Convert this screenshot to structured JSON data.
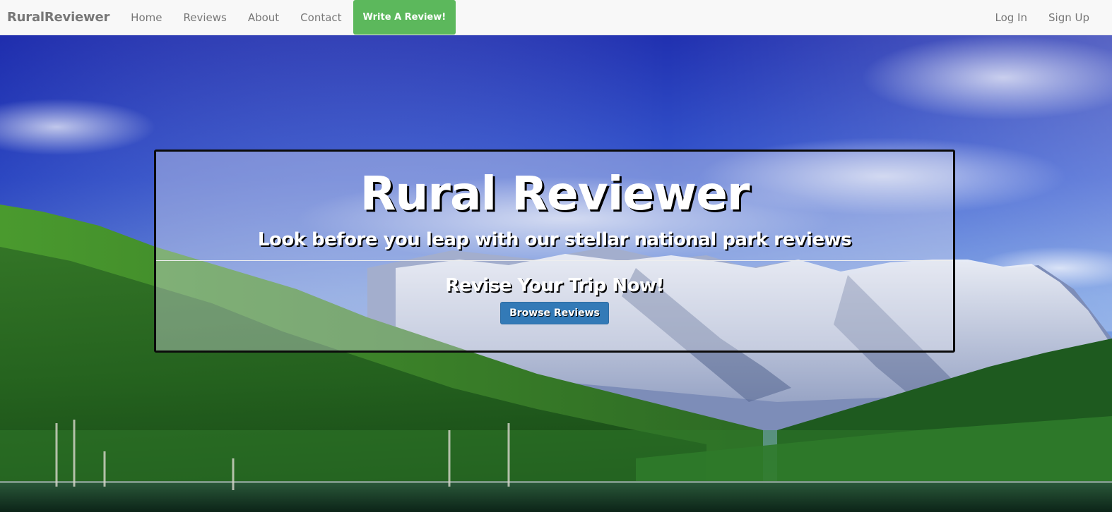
{
  "navbar": {
    "brand": "RuralReviewer",
    "links": [
      "Home",
      "Reviews",
      "About",
      "Contact"
    ],
    "cta": "Write A Review!",
    "right_links": [
      "Log In",
      "Sign Up"
    ]
  },
  "hero": {
    "title": "Rural Reviewer",
    "subtitle": "Look before you leap with our stellar national park reviews",
    "call_to_action": "Revise Your Trip Now!",
    "button": "Browse Reviews"
  },
  "colors": {
    "navbar_bg": "#f8f8f8",
    "cta_green": "#5cb85c",
    "button_blue": "#337ab7",
    "sky_top": "#2233b8",
    "sky_bottom": "#6a9ee6"
  }
}
